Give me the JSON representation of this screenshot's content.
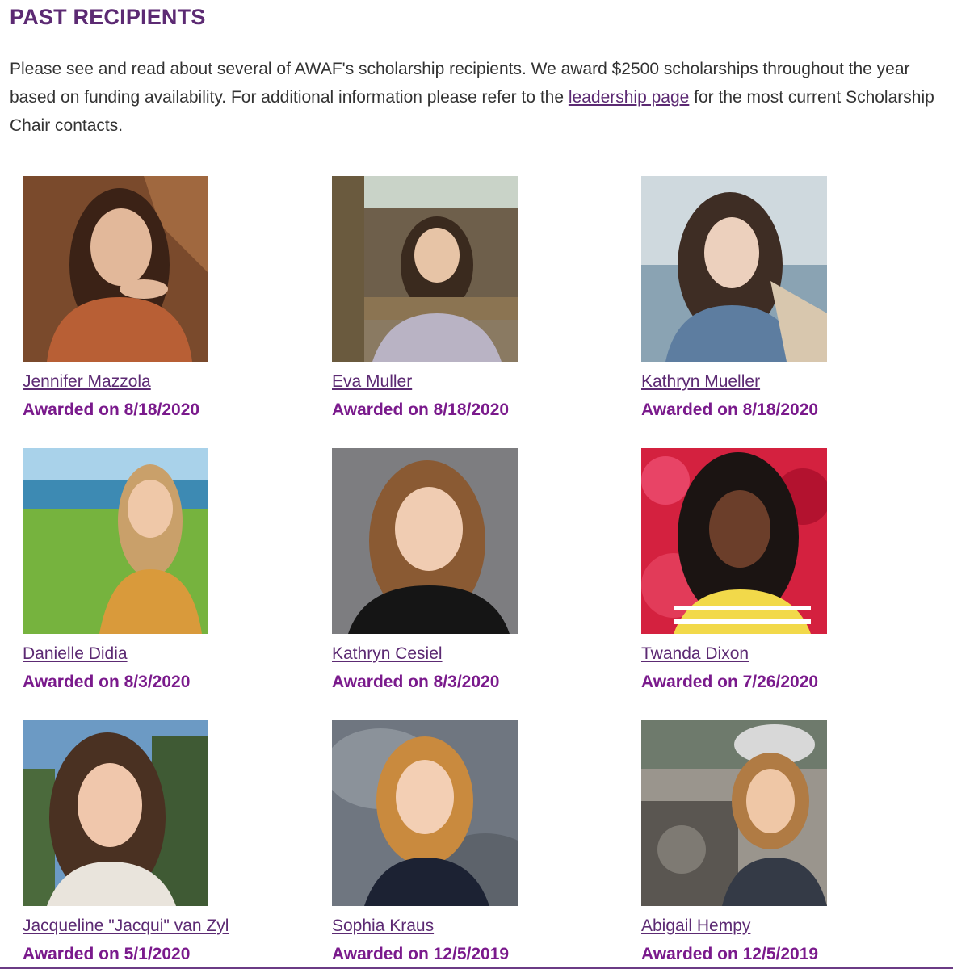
{
  "heading": "PAST RECIPIENTS",
  "intro": {
    "text_before": "Please see and read about several of AWAF's scholarship recipients.  We award $2500 scholarships throughout the year based on funding availability. For additional information please refer to the ",
    "link": "leadership page",
    "text_after": " for the most current Scholarship Chair contacts."
  },
  "recipients": [
    {
      "name": "Jennifer Mazzola",
      "award": "Awarded on 8/18/2020",
      "photo": "portrait-photo"
    },
    {
      "name": "Eva Muller",
      "award": "Awarded on 8/18/2020",
      "photo": "portrait-photo"
    },
    {
      "name": "Kathryn Mueller",
      "award": "Awarded on 8/18/2020",
      "photo": "portrait-photo"
    },
    {
      "name": "Danielle Didia",
      "award": "Awarded on 8/3/2020",
      "photo": "portrait-photo"
    },
    {
      "name": "Kathryn Cesiel",
      "award": "Awarded on 8/3/2020",
      "photo": "portrait-photo"
    },
    {
      "name": "Twanda Dixon",
      "award": "Awarded on 7/26/2020",
      "photo": "portrait-photo"
    },
    {
      "name": "Jacqueline \"Jacqui\" van Zyl",
      "award": "Awarded on 5/1/2020",
      "photo": "portrait-photo"
    },
    {
      "name": "Sophia Kraus",
      "award": "Awarded on 12/5/2019",
      "photo": "portrait-photo"
    },
    {
      "name": "Abigail Hempy",
      "award": "Awarded on 12/5/2019",
      "photo": "portrait-photo"
    }
  ],
  "colors": {
    "heading": "#5c2a73",
    "link": "#5c2a73",
    "award": "#7a1a8c",
    "body_text": "#333333"
  }
}
